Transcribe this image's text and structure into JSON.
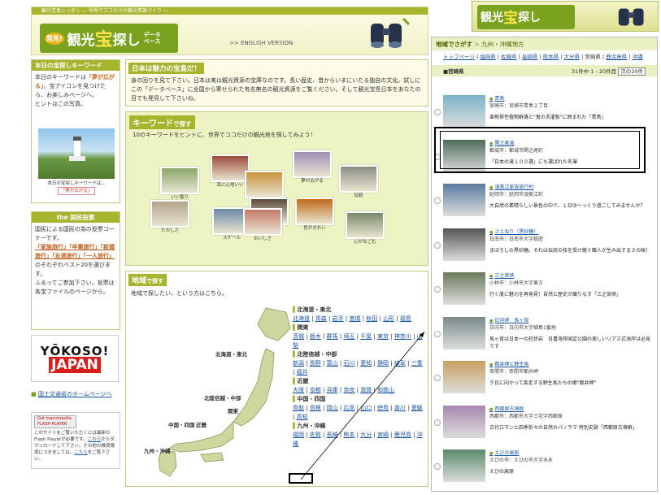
{
  "header": {
    "top_left": "観光宝島ニッポン",
    "top_tag": "— 世界でココだけの観光資源づくり —",
    "logo_hatsu": "発見!",
    "logo_kanko": "観光",
    "logo_takara": "宝",
    "logo_sagashi": "探し",
    "logo_db_1": "データ",
    "logo_db_2": "ベース",
    "english_link": ">> ENGLISH VERSION"
  },
  "keyword_box": {
    "title": "本日の宝探しキーワード",
    "text_1": "本日のキーワードは「",
    "keyword": "夢が広がる",
    "text_2": "」。宝アイコンを見つけたら、お楽しみページへ。",
    "text_3": "ヒントはこの写真。",
    "caption_1": "本日の宝探しキーワードは...",
    "caption_2": "「夢が広がる」"
  },
  "vote_box": {
    "title": "the 国民投票",
    "p1": "国民による国民の為の投票コーナーです。",
    "kw1": "「家族旅行」",
    "kw2": "「卒業旅行」",
    "kw3": "「新婚旅行」",
    "kw4": "「友達旅行」",
    "kw5": "「一人旅行」",
    "p2": "のそれぞれベスト20を選びます。",
    "p3": "ふるってご参加下さい。投票は各宝ファイルのページから。"
  },
  "yokoso": {
    "line1": "YŌKOSO!",
    "line2": "JAPAN"
  },
  "mlit_link": "国土交通省のホームページへ",
  "flash": {
    "button": "Get macromedia FLASH PLAYER",
    "text_1": "このサイトをご覧いただくには最新のFlash Playerが必要です。",
    "link_1": "こちら",
    "text_2": "からダウンロードして下さい。その他の推奨環境につきましては、",
    "link_2": "こちら",
    "text_3": "をご覧下さい。"
  },
  "intro": {
    "title": "日本は魅力の宝島だ！",
    "body": "身の回りを見て下さい。日本は実は観光資源の宝庫なのです。長い歴史、昔からいまにいたる独自の文化。試しにこの「データベース」に全国から寄せられた有名無名の観光資源をご覧ください。そして観光宝島日本をあなたの目でも発見して下さいね。"
  },
  "keyword_search": {
    "title_main": "キーワード",
    "title_rest": "で探す",
    "subtitle": "10のキーワードをヒントに、世界でココだけの観光地を探してみよう！",
    "thumbs": [
      {
        "label": "いい香り",
        "color": "#8aa86a"
      },
      {
        "label": "耳に心地いい",
        "color": "#9c4a3a"
      },
      {
        "label": "夢が広がる",
        "color": "#a08db8"
      },
      {
        "label": "伝統",
        "color": "#8e8e86"
      },
      {
        "label": "たのしさ",
        "color": "#b3a48a"
      },
      {
        "label": "",
        "color": "#c9923c"
      },
      {
        "label": "",
        "color": "#5a4a3a"
      },
      {
        "label": "スケール",
        "color": "#6a88a8"
      },
      {
        "label": "おいしさ",
        "color": "#c47a6a"
      },
      {
        "label": "色がきれい",
        "color": "#c06a1a"
      },
      {
        "label": "心がなごむ",
        "color": "#7a8a6a"
      }
    ]
  },
  "area_search": {
    "title_main": "地域",
    "title_rest": "で探す",
    "subtitle": "地域で探したい、という方はこちら。",
    "map_labels": [
      "北海道・東北",
      "北陸信越・中部",
      "関東",
      "中国・四国",
      "近畿",
      "九州・沖縄"
    ],
    "regions": [
      {
        "name": "北海道・東北",
        "links": [
          "北海道",
          "青森",
          "岩手",
          "宮城",
          "秋田",
          "山形",
          "福島"
        ]
      },
      {
        "name": "関東",
        "links": [
          "茨城",
          "栃木",
          "群馬",
          "埼玉",
          "千葉",
          "東京",
          "神奈川",
          "山梨"
        ]
      },
      {
        "name": "北陸信越・中部",
        "links": [
          "新潟",
          "長野",
          "富山",
          "石川",
          "愛知",
          "静岡",
          "岐阜",
          "三重",
          "福井"
        ]
      },
      {
        "name": "近畿",
        "links": [
          "大阪",
          "京都",
          "兵庫",
          "奈良",
          "滋賀",
          "和歌山"
        ]
      },
      {
        "name": "中国・四国",
        "links": [
          "鳥取",
          "島根",
          "岡山",
          "広島",
          "山口",
          "徳島",
          "香川",
          "愛媛",
          "高知"
        ]
      },
      {
        "name": "九州・沖縄",
        "links": [
          "福岡",
          "佐賀",
          "長崎",
          "熊本",
          "大分",
          "宮崎",
          "鹿児島",
          "沖縄"
        ]
      }
    ]
  },
  "right_panel": {
    "header_label": "地域でさがす",
    "header_region": "九州・沖縄地方",
    "crumb_top": "トップページ",
    "crumb_links": [
      "福岡県",
      "佐賀県",
      "長崎県",
      "熊本県",
      "大分県",
      "宮崎県",
      "鹿児島県",
      "沖縄"
    ],
    "list_label": "■宮崎県",
    "count": "31件中 1 - 20件目",
    "next": "次の20件",
    "items": [
      {
        "title": "青島",
        "addr": "宮崎市：宮崎市青島２丁目",
        "desc": "亜熱帯性植物群落と\"鬼の洗濯板\"に囲まれた「青島」",
        "color": "#7ab2c8"
      },
      {
        "title": "関之尾滝",
        "addr": "都城市：都城市関之尾町",
        "desc": "「日本の滝１００選」にも選ばれた名瀑",
        "color": "#4e6a5a"
      },
      {
        "title": "須美江家族旅行村",
        "addr": "延岡市：延岡市須美江町",
        "desc": "大自然の素晴らしい景色の中で、１日ゆ～っくり過ごしてみませんか？",
        "color": "#5a7aa0"
      },
      {
        "title": "さとねり（黒砂糖）",
        "addr": "日南市：日南市大字飫肥",
        "desc": "まぼろしの黒砂糖。それは伝統の技を受け継ぐ職人が生み出すまさの味！",
        "color": "#555"
      },
      {
        "title": "三之宮峡",
        "addr": "小林市：小林市大字東方",
        "desc": "行く度に魅力を再発見！自然と歴史が織りなす「三之宮峡」",
        "color": "#6a7a5a"
      },
      {
        "title": "日向岬　馬ヶ背",
        "addr": "日向市：日向市大字細島1番地",
        "desc": "馬ヶ背は日本一の柱状岩　日豊海岸国定公園の美しいリアス式海岸は必見です",
        "color": "#7a8a8a"
      },
      {
        "title": "都井岬と野生馬",
        "addr": "串間市：串間市都井岬",
        "desc": "夕日に向かって疾走する野生馬たちの郷\"都井岬\"",
        "color": "#c8a060"
      },
      {
        "title": "西都原古墳群",
        "addr": "西都市：西都市大字三宅字西都原",
        "desc": "古代ロマンと四季折々の自然のパノラマ 特別史跡「西都原古墳群」",
        "color": "#a888b0"
      },
      {
        "title": "えびの高原",
        "addr": "えびの市：えびの市大字末永",
        "desc": "えびの高原",
        "color": "#5a8a6a"
      }
    ]
  }
}
